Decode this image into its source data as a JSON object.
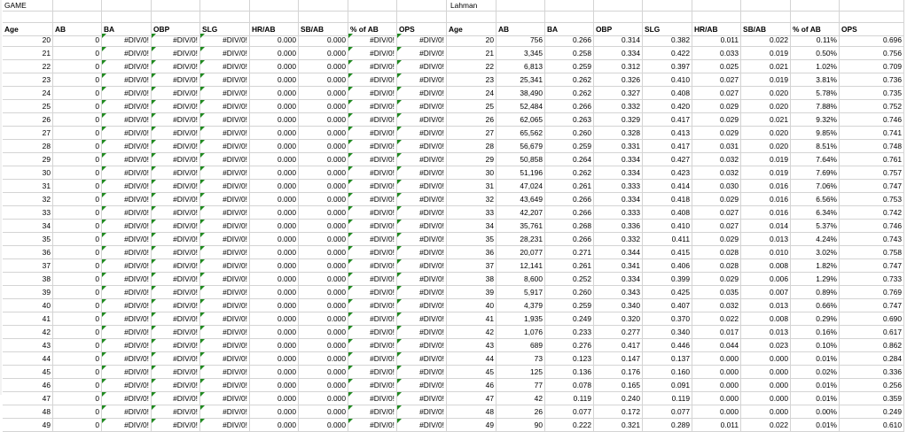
{
  "title_left": "GAME",
  "title_right": "Lahman",
  "headers_left": [
    "Age",
    "AB",
    "BA",
    "OBP",
    "SLG",
    "HR/AB",
    "SB/AB",
    "% of AB",
    "OPS"
  ],
  "headers_right": [
    "Age",
    "AB",
    "BA",
    "OBP",
    "SLG",
    "HR/AB",
    "SB/AB",
    "% of AB",
    "OPS"
  ],
  "left_rows": [
    [
      "20",
      "0",
      "#DIV/0!",
      "#DIV/0!",
      "#DIV/0!",
      "0.000",
      "0.000",
      "#DIV/0!",
      "#DIV/0!"
    ],
    [
      "21",
      "0",
      "#DIV/0!",
      "#DIV/0!",
      "#DIV/0!",
      "0.000",
      "0.000",
      "#DIV/0!",
      "#DIV/0!"
    ],
    [
      "22",
      "0",
      "#DIV/0!",
      "#DIV/0!",
      "#DIV/0!",
      "0.000",
      "0.000",
      "#DIV/0!",
      "#DIV/0!"
    ],
    [
      "23",
      "0",
      "#DIV/0!",
      "#DIV/0!",
      "#DIV/0!",
      "0.000",
      "0.000",
      "#DIV/0!",
      "#DIV/0!"
    ],
    [
      "24",
      "0",
      "#DIV/0!",
      "#DIV/0!",
      "#DIV/0!",
      "0.000",
      "0.000",
      "#DIV/0!",
      "#DIV/0!"
    ],
    [
      "25",
      "0",
      "#DIV/0!",
      "#DIV/0!",
      "#DIV/0!",
      "0.000",
      "0.000",
      "#DIV/0!",
      "#DIV/0!"
    ],
    [
      "26",
      "0",
      "#DIV/0!",
      "#DIV/0!",
      "#DIV/0!",
      "0.000",
      "0.000",
      "#DIV/0!",
      "#DIV/0!"
    ],
    [
      "27",
      "0",
      "#DIV/0!",
      "#DIV/0!",
      "#DIV/0!",
      "0.000",
      "0.000",
      "#DIV/0!",
      "#DIV/0!"
    ],
    [
      "28",
      "0",
      "#DIV/0!",
      "#DIV/0!",
      "#DIV/0!",
      "0.000",
      "0.000",
      "#DIV/0!",
      "#DIV/0!"
    ],
    [
      "29",
      "0",
      "#DIV/0!",
      "#DIV/0!",
      "#DIV/0!",
      "0.000",
      "0.000",
      "#DIV/0!",
      "#DIV/0!"
    ],
    [
      "30",
      "0",
      "#DIV/0!",
      "#DIV/0!",
      "#DIV/0!",
      "0.000",
      "0.000",
      "#DIV/0!",
      "#DIV/0!"
    ],
    [
      "31",
      "0",
      "#DIV/0!",
      "#DIV/0!",
      "#DIV/0!",
      "0.000",
      "0.000",
      "#DIV/0!",
      "#DIV/0!"
    ],
    [
      "32",
      "0",
      "#DIV/0!",
      "#DIV/0!",
      "#DIV/0!",
      "0.000",
      "0.000",
      "#DIV/0!",
      "#DIV/0!"
    ],
    [
      "33",
      "0",
      "#DIV/0!",
      "#DIV/0!",
      "#DIV/0!",
      "0.000",
      "0.000",
      "#DIV/0!",
      "#DIV/0!"
    ],
    [
      "34",
      "0",
      "#DIV/0!",
      "#DIV/0!",
      "#DIV/0!",
      "0.000",
      "0.000",
      "#DIV/0!",
      "#DIV/0!"
    ],
    [
      "35",
      "0",
      "#DIV/0!",
      "#DIV/0!",
      "#DIV/0!",
      "0.000",
      "0.000",
      "#DIV/0!",
      "#DIV/0!"
    ],
    [
      "36",
      "0",
      "#DIV/0!",
      "#DIV/0!",
      "#DIV/0!",
      "0.000",
      "0.000",
      "#DIV/0!",
      "#DIV/0!"
    ],
    [
      "37",
      "0",
      "#DIV/0!",
      "#DIV/0!",
      "#DIV/0!",
      "0.000",
      "0.000",
      "#DIV/0!",
      "#DIV/0!"
    ],
    [
      "38",
      "0",
      "#DIV/0!",
      "#DIV/0!",
      "#DIV/0!",
      "0.000",
      "0.000",
      "#DIV/0!",
      "#DIV/0!"
    ],
    [
      "39",
      "0",
      "#DIV/0!",
      "#DIV/0!",
      "#DIV/0!",
      "0.000",
      "0.000",
      "#DIV/0!",
      "#DIV/0!"
    ],
    [
      "40",
      "0",
      "#DIV/0!",
      "#DIV/0!",
      "#DIV/0!",
      "0.000",
      "0.000",
      "#DIV/0!",
      "#DIV/0!"
    ],
    [
      "41",
      "0",
      "#DIV/0!",
      "#DIV/0!",
      "#DIV/0!",
      "0.000",
      "0.000",
      "#DIV/0!",
      "#DIV/0!"
    ],
    [
      "42",
      "0",
      "#DIV/0!",
      "#DIV/0!",
      "#DIV/0!",
      "0.000",
      "0.000",
      "#DIV/0!",
      "#DIV/0!"
    ],
    [
      "43",
      "0",
      "#DIV/0!",
      "#DIV/0!",
      "#DIV/0!",
      "0.000",
      "0.000",
      "#DIV/0!",
      "#DIV/0!"
    ],
    [
      "44",
      "0",
      "#DIV/0!",
      "#DIV/0!",
      "#DIV/0!",
      "0.000",
      "0.000",
      "#DIV/0!",
      "#DIV/0!"
    ],
    [
      "45",
      "0",
      "#DIV/0!",
      "#DIV/0!",
      "#DIV/0!",
      "0.000",
      "0.000",
      "#DIV/0!",
      "#DIV/0!"
    ],
    [
      "46",
      "0",
      "#DIV/0!",
      "#DIV/0!",
      "#DIV/0!",
      "0.000",
      "0.000",
      "#DIV/0!",
      "#DIV/0!"
    ],
    [
      "47",
      "0",
      "#DIV/0!",
      "#DIV/0!",
      "#DIV/0!",
      "0.000",
      "0.000",
      "#DIV/0!",
      "#DIV/0!"
    ],
    [
      "48",
      "0",
      "#DIV/0!",
      "#DIV/0!",
      "#DIV/0!",
      "0.000",
      "0.000",
      "#DIV/0!",
      "#DIV/0!"
    ],
    [
      "49",
      "0",
      "#DIV/0!",
      "#DIV/0!",
      "#DIV/0!",
      "0.000",
      "0.000",
      "#DIV/0!",
      "#DIV/0!"
    ]
  ],
  "right_rows": [
    [
      "20",
      "756",
      "0.266",
      "0.314",
      "0.382",
      "0.011",
      "0.022",
      "0.11%",
      "0.696"
    ],
    [
      "21",
      "3,345",
      "0.258",
      "0.334",
      "0.422",
      "0.033",
      "0.019",
      "0.50%",
      "0.756"
    ],
    [
      "22",
      "6,813",
      "0.259",
      "0.312",
      "0.397",
      "0.025",
      "0.021",
      "1.02%",
      "0.709"
    ],
    [
      "23",
      "25,341",
      "0.262",
      "0.326",
      "0.410",
      "0.027",
      "0.019",
      "3.81%",
      "0.736"
    ],
    [
      "24",
      "38,490",
      "0.262",
      "0.327",
      "0.408",
      "0.027",
      "0.020",
      "5.78%",
      "0.735"
    ],
    [
      "25",
      "52,484",
      "0.266",
      "0.332",
      "0.420",
      "0.029",
      "0.020",
      "7.88%",
      "0.752"
    ],
    [
      "26",
      "62,065",
      "0.263",
      "0.329",
      "0.417",
      "0.029",
      "0.021",
      "9.32%",
      "0.746"
    ],
    [
      "27",
      "65,562",
      "0.260",
      "0.328",
      "0.413",
      "0.029",
      "0.020",
      "9.85%",
      "0.741"
    ],
    [
      "28",
      "56,679",
      "0.259",
      "0.331",
      "0.417",
      "0.031",
      "0.020",
      "8.51%",
      "0.748"
    ],
    [
      "29",
      "50,858",
      "0.264",
      "0.334",
      "0.427",
      "0.032",
      "0.019",
      "7.64%",
      "0.761"
    ],
    [
      "30",
      "51,196",
      "0.262",
      "0.334",
      "0.423",
      "0.032",
      "0.019",
      "7.69%",
      "0.757"
    ],
    [
      "31",
      "47,024",
      "0.261",
      "0.333",
      "0.414",
      "0.030",
      "0.016",
      "7.06%",
      "0.747"
    ],
    [
      "32",
      "43,649",
      "0.266",
      "0.334",
      "0.418",
      "0.029",
      "0.016",
      "6.56%",
      "0.753"
    ],
    [
      "33",
      "42,207",
      "0.266",
      "0.333",
      "0.408",
      "0.027",
      "0.016",
      "6.34%",
      "0.742"
    ],
    [
      "34",
      "35,761",
      "0.268",
      "0.336",
      "0.410",
      "0.027",
      "0.014",
      "5.37%",
      "0.746"
    ],
    [
      "35",
      "28,231",
      "0.266",
      "0.332",
      "0.411",
      "0.029",
      "0.013",
      "4.24%",
      "0.743"
    ],
    [
      "36",
      "20,077",
      "0.271",
      "0.344",
      "0.415",
      "0.028",
      "0.010",
      "3.02%",
      "0.758"
    ],
    [
      "37",
      "12,141",
      "0.261",
      "0.341",
      "0.406",
      "0.028",
      "0.008",
      "1.82%",
      "0.747"
    ],
    [
      "38",
      "8,600",
      "0.252",
      "0.334",
      "0.399",
      "0.029",
      "0.006",
      "1.29%",
      "0.733"
    ],
    [
      "39",
      "5,917",
      "0.260",
      "0.343",
      "0.425",
      "0.035",
      "0.007",
      "0.89%",
      "0.769"
    ],
    [
      "40",
      "4,379",
      "0.259",
      "0.340",
      "0.407",
      "0.032",
      "0.013",
      "0.66%",
      "0.747"
    ],
    [
      "41",
      "1,935",
      "0.249",
      "0.320",
      "0.370",
      "0.022",
      "0.008",
      "0.29%",
      "0.690"
    ],
    [
      "42",
      "1,076",
      "0.233",
      "0.277",
      "0.340",
      "0.017",
      "0.013",
      "0.16%",
      "0.617"
    ],
    [
      "43",
      "689",
      "0.276",
      "0.417",
      "0.446",
      "0.044",
      "0.023",
      "0.10%",
      "0.862"
    ],
    [
      "44",
      "73",
      "0.123",
      "0.147",
      "0.137",
      "0.000",
      "0.000",
      "0.01%",
      "0.284"
    ],
    [
      "45",
      "125",
      "0.136",
      "0.176",
      "0.160",
      "0.000",
      "0.000",
      "0.02%",
      "0.336"
    ],
    [
      "46",
      "77",
      "0.078",
      "0.165",
      "0.091",
      "0.000",
      "0.000",
      "0.01%",
      "0.256"
    ],
    [
      "47",
      "42",
      "0.119",
      "0.240",
      "0.119",
      "0.000",
      "0.000",
      "0.01%",
      "0.359"
    ],
    [
      "48",
      "26",
      "0.077",
      "0.172",
      "0.077",
      "0.000",
      "0.000",
      "0.00%",
      "0.249"
    ],
    [
      "49",
      "90",
      "0.222",
      "0.321",
      "0.289",
      "0.011",
      "0.022",
      "0.01%",
      "0.610"
    ]
  ],
  "colors": {
    "grid": "#d4d4d4",
    "error_marker": "#1f8a1f"
  }
}
